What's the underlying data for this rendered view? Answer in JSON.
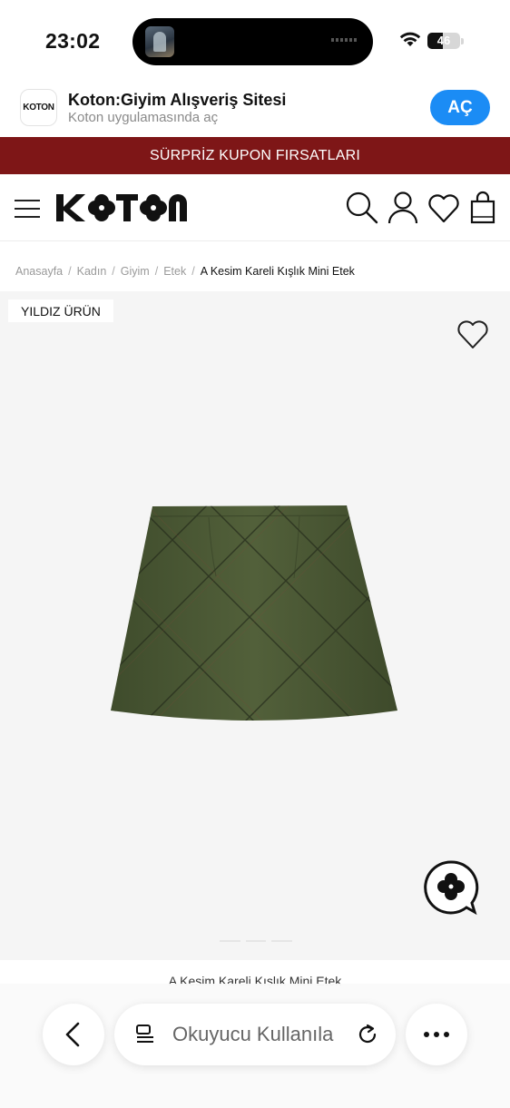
{
  "status_bar": {
    "time": "23:02",
    "battery": "46",
    "battery_level": 0.46
  },
  "app_banner": {
    "icon_text": "KOTON",
    "title": "Koton:Giyim Alışveriş Sitesi",
    "subtitle": "Koton uygulamasında aç",
    "open_label": "AÇ",
    "accent": "#1b8cf5"
  },
  "promo": {
    "text": "SÜRPRİZ KUPON FIRSATLARI",
    "color": "#7e1617"
  },
  "header": {
    "logo_text": "KOTON",
    "icons": [
      "menu-icon",
      "search-icon",
      "user-icon",
      "heart-icon",
      "bag-icon"
    ]
  },
  "breadcrumb": {
    "items": [
      "Anasayfa",
      "Kadın",
      "Giyim",
      "Etek"
    ],
    "current": "A Kesim Kareli Kışlık Mini Etek",
    "separator": "/"
  },
  "product": {
    "badge": "YILDIZ ÜRÜN",
    "title": "A Kesim Kareli Kışlık Mini Etek",
    "image_alt": "olive green plaid mini skirt",
    "skirt_color": "#4a5834"
  },
  "safari": {
    "url_text": "Okuyucu Kullanıla",
    "icons": [
      "back-icon",
      "reader-icon",
      "reload-icon",
      "more-icon"
    ]
  }
}
